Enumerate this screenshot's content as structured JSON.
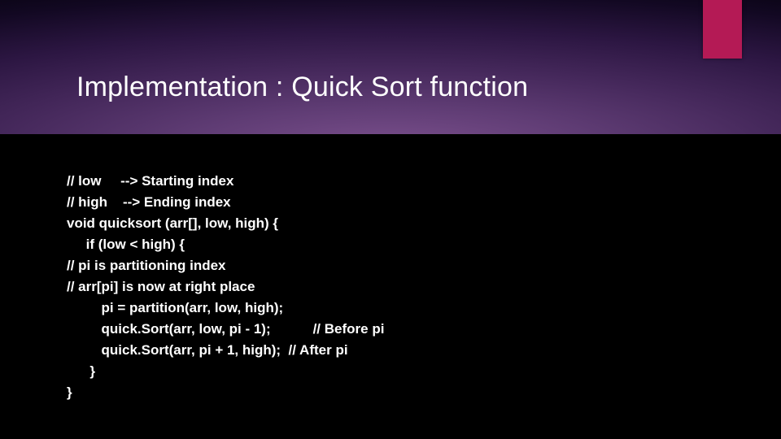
{
  "title": "Implementation : Quick Sort function",
  "code": {
    "l1": "// low     --> Starting index",
    "l2": "// high    --> Ending index",
    "l3": "void quicksort (arr[], low, high) {",
    "l4": "     if (low < high) {",
    "l5": "// pi is partitioning index",
    "l6": "// arr[pi] is now at right place",
    "l7": "         pi = partition(arr, low, high);",
    "l8": "         quick.Sort(arr, low, pi - 1);           // Before pi",
    "l9": "         quick.Sort(arr, pi + 1, high);  // After pi",
    "l10": "      }",
    "l11": "}"
  }
}
